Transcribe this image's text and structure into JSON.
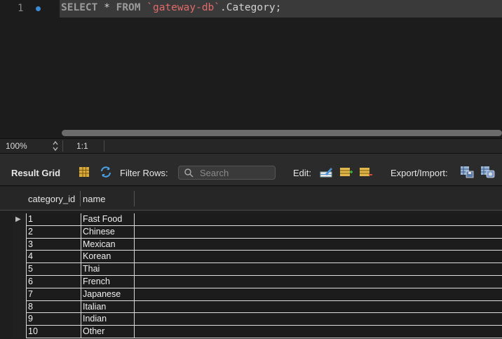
{
  "editor": {
    "line_number": "1",
    "code": {
      "select": "SELECT",
      "star": " * ",
      "from": "FROM",
      "space": " ",
      "schema": "`gateway-db`",
      "rest": ".Category;"
    }
  },
  "status": {
    "zoom": "100%",
    "ratio": "1:1"
  },
  "toolbar": {
    "result_grid": "Result Grid",
    "filter_rows": "Filter Rows:",
    "search_placeholder": "Search",
    "edit": "Edit:",
    "export_import": "Export/Import:"
  },
  "grid": {
    "columns": [
      "category_id",
      "name"
    ],
    "rows": [
      {
        "id": "1",
        "name": "Fast Food"
      },
      {
        "id": "2",
        "name": "Chinese"
      },
      {
        "id": "3",
        "name": "Mexican"
      },
      {
        "id": "4",
        "name": "Korean"
      },
      {
        "id": "5",
        "name": "Thai"
      },
      {
        "id": "6",
        "name": "French"
      },
      {
        "id": "7",
        "name": "Japanese"
      },
      {
        "id": "8",
        "name": "Italian"
      },
      {
        "id": "9",
        "name": "Indian"
      },
      {
        "id": "10",
        "name": "Other"
      }
    ]
  },
  "colors": {
    "keyword": "#9a9a9a",
    "string": "#e26a6a",
    "accent": "#3a8bd6"
  }
}
